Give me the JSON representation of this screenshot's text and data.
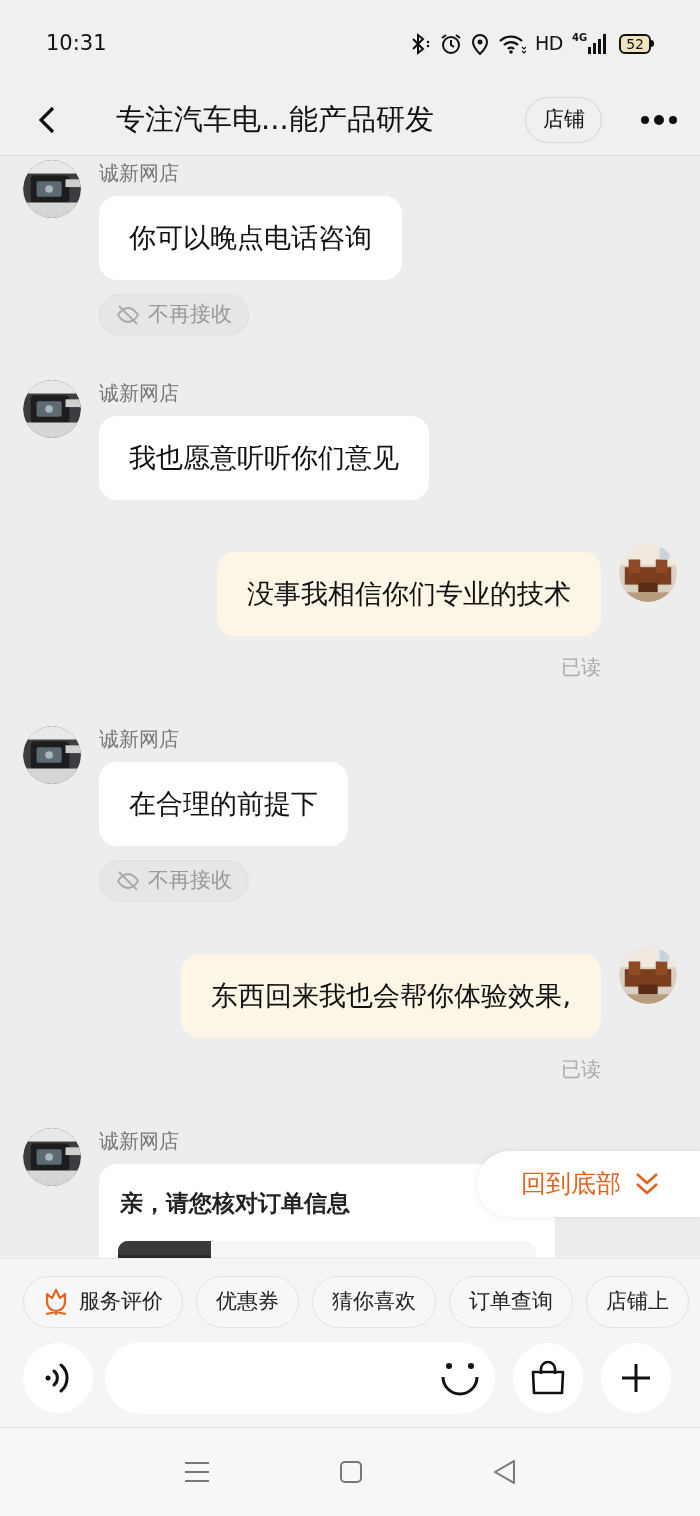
{
  "status_bar": {
    "time": "10:31",
    "network_label": "HD",
    "network_type": "4G",
    "battery": "52"
  },
  "header": {
    "title": "专注汽车电...能产品研发",
    "shop_button": "店铺"
  },
  "messages": [
    {
      "kind": "incoming",
      "sender": "诚新网店",
      "text": "你可以晚点电话咨询",
      "reject_label": "不再接收"
    },
    {
      "kind": "incoming",
      "sender": "诚新网店",
      "text": "我也愿意听听你们意见"
    },
    {
      "kind": "outgoing",
      "text": "没事我相信你们专业的技术",
      "read_status": "已读"
    },
    {
      "kind": "incoming",
      "sender": "诚新网店",
      "text": "在合理的前提下",
      "reject_label": "不再接收"
    },
    {
      "kind": "outgoing",
      "text": "东西回来我也会帮你体验效果,",
      "read_status": "已读"
    },
    {
      "kind": "order_card",
      "sender": "诚新网店",
      "title": "亲，请您核对订单信息"
    }
  ],
  "back_to_bottom": "回到底部",
  "quick_chips": [
    {
      "label": "服务评价",
      "kind": "icon"
    },
    {
      "label": "优惠券",
      "kind": "plain"
    },
    {
      "label": "猜你喜欢",
      "kind": "plain"
    },
    {
      "label": "订单查询",
      "kind": "plain"
    },
    {
      "label": "店铺上",
      "kind": "plain"
    }
  ]
}
